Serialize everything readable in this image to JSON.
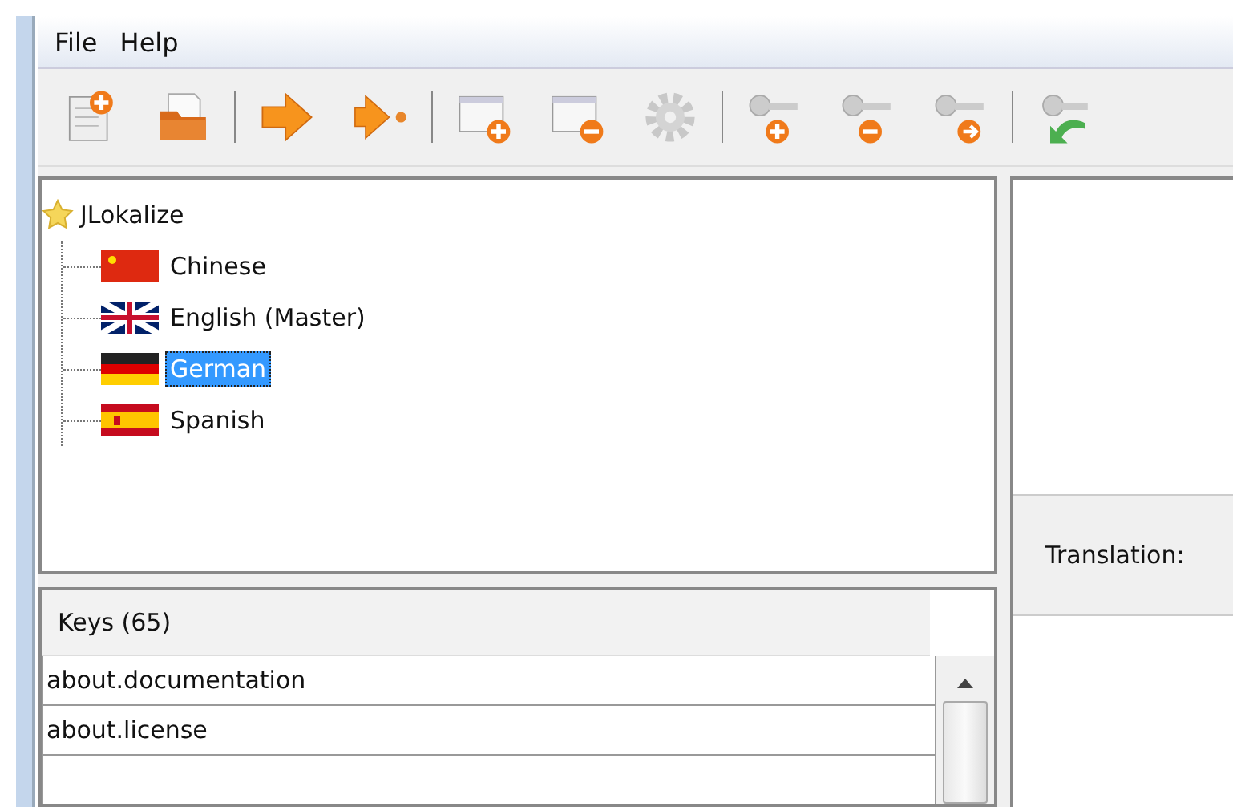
{
  "menu": [
    "File",
    "Help"
  ],
  "tree": {
    "label": "JLokalize",
    "children": [
      {
        "label": "Chinese",
        "selected": false
      },
      {
        "label": "English (Master)",
        "selected": false
      },
      {
        "label": "German",
        "selected": true
      },
      {
        "label": "Spanish",
        "selected": false
      }
    ]
  },
  "keys_table": {
    "header": "Keys (65)",
    "rows": [
      "about.documentation",
      "about.license"
    ]
  },
  "translation_label": "Translation:"
}
